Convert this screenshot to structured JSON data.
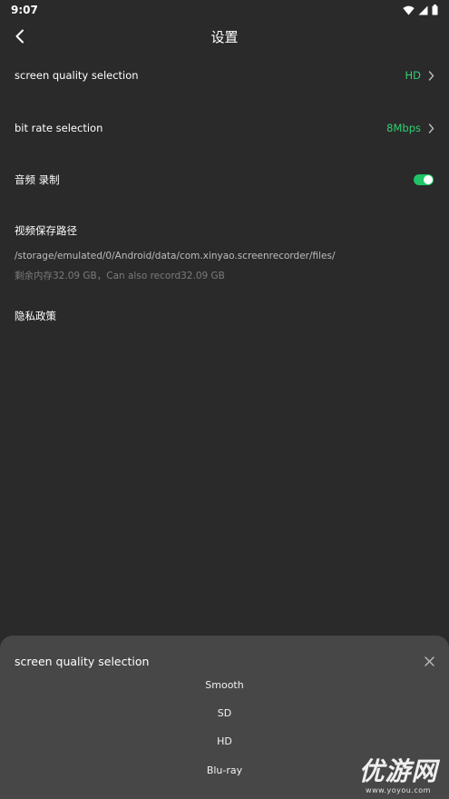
{
  "status_bar": {
    "time": "9:07"
  },
  "app_bar": {
    "title": "设置"
  },
  "settings": {
    "screen_quality": {
      "label": "screen quality selection",
      "value": "HD"
    },
    "bit_rate": {
      "label": "bit rate selection",
      "value": "8Mbps"
    },
    "audio_recording": {
      "label": "音频 录制",
      "enabled": true
    },
    "save_path": {
      "label": "视频保存路径",
      "path": "/storage/emulated/0/Android/data/com.xinyao.screenrecorder/files/",
      "storage_info": "剩余内存32.09 GB，Can also record32.09 GB"
    },
    "privacy_policy": {
      "label": "隐私政策"
    }
  },
  "quality_sheet": {
    "title": "screen quality selection",
    "options": [
      "Smooth",
      "SD",
      "HD",
      "Blu-ray"
    ]
  },
  "watermark": {
    "text": "优游网",
    "url": "www.yoyou.com"
  },
  "colors": {
    "accent": "#2fd071",
    "background": "#2a2a2a",
    "sheet": "#474747"
  },
  "icons": [
    "wifi-icon",
    "signal-icon",
    "battery-icon",
    "back-arrow-icon",
    "chevron-right-icon",
    "close-icon"
  ]
}
